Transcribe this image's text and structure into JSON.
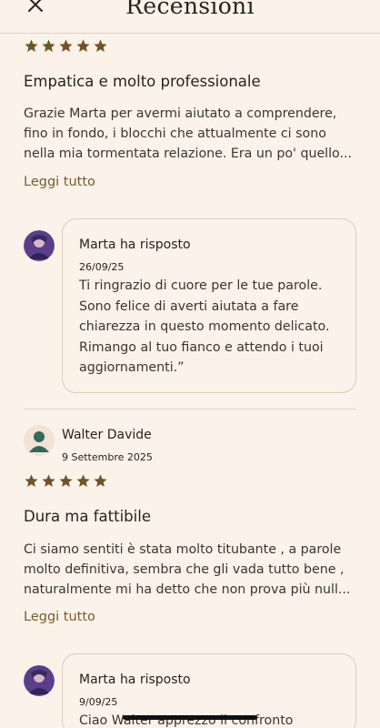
{
  "header": {
    "title": "Recensioni"
  },
  "colors": {
    "background": "#fbf3ea",
    "star": "#6e5426",
    "link": "#7a5a2c"
  },
  "review1": {
    "rating": 5,
    "title": "Empatica e molto professionale",
    "body": "Grazie Marta per avermi aiutato a comprendere, fino in fondo, i blocchi che attualmente ci sono nella mia tormentata relazione. Era un po' quello...",
    "read_more": "Leggi tutto",
    "reply": {
      "author": "Marta",
      "action": "ha risposto",
      "date": "26/09/25",
      "text": "Ti ringrazio di cuore per le tue parole. Sono felice di averti aiutata a fare chiarezza in questo momento delicato. Rimango al tuo fianco e attendo i tuoi aggiornamenti.”"
    }
  },
  "review2": {
    "author": "Walter Davide",
    "date": "9 Settembre 2025",
    "rating": 5,
    "title": "Dura ma fattibile",
    "body": "Ci siamo sentiti è stata molto titubante , a parole molto definitiva, sembra che gli vada tutto bene , naturalmente mi ha detto che non prova più null...",
    "read_more": "Leggi tutto",
    "reply": {
      "author": "Marta",
      "action": "ha risposto",
      "date": "9/09/25",
      "text": "Ciao Walter apprezzo il confronto"
    }
  }
}
